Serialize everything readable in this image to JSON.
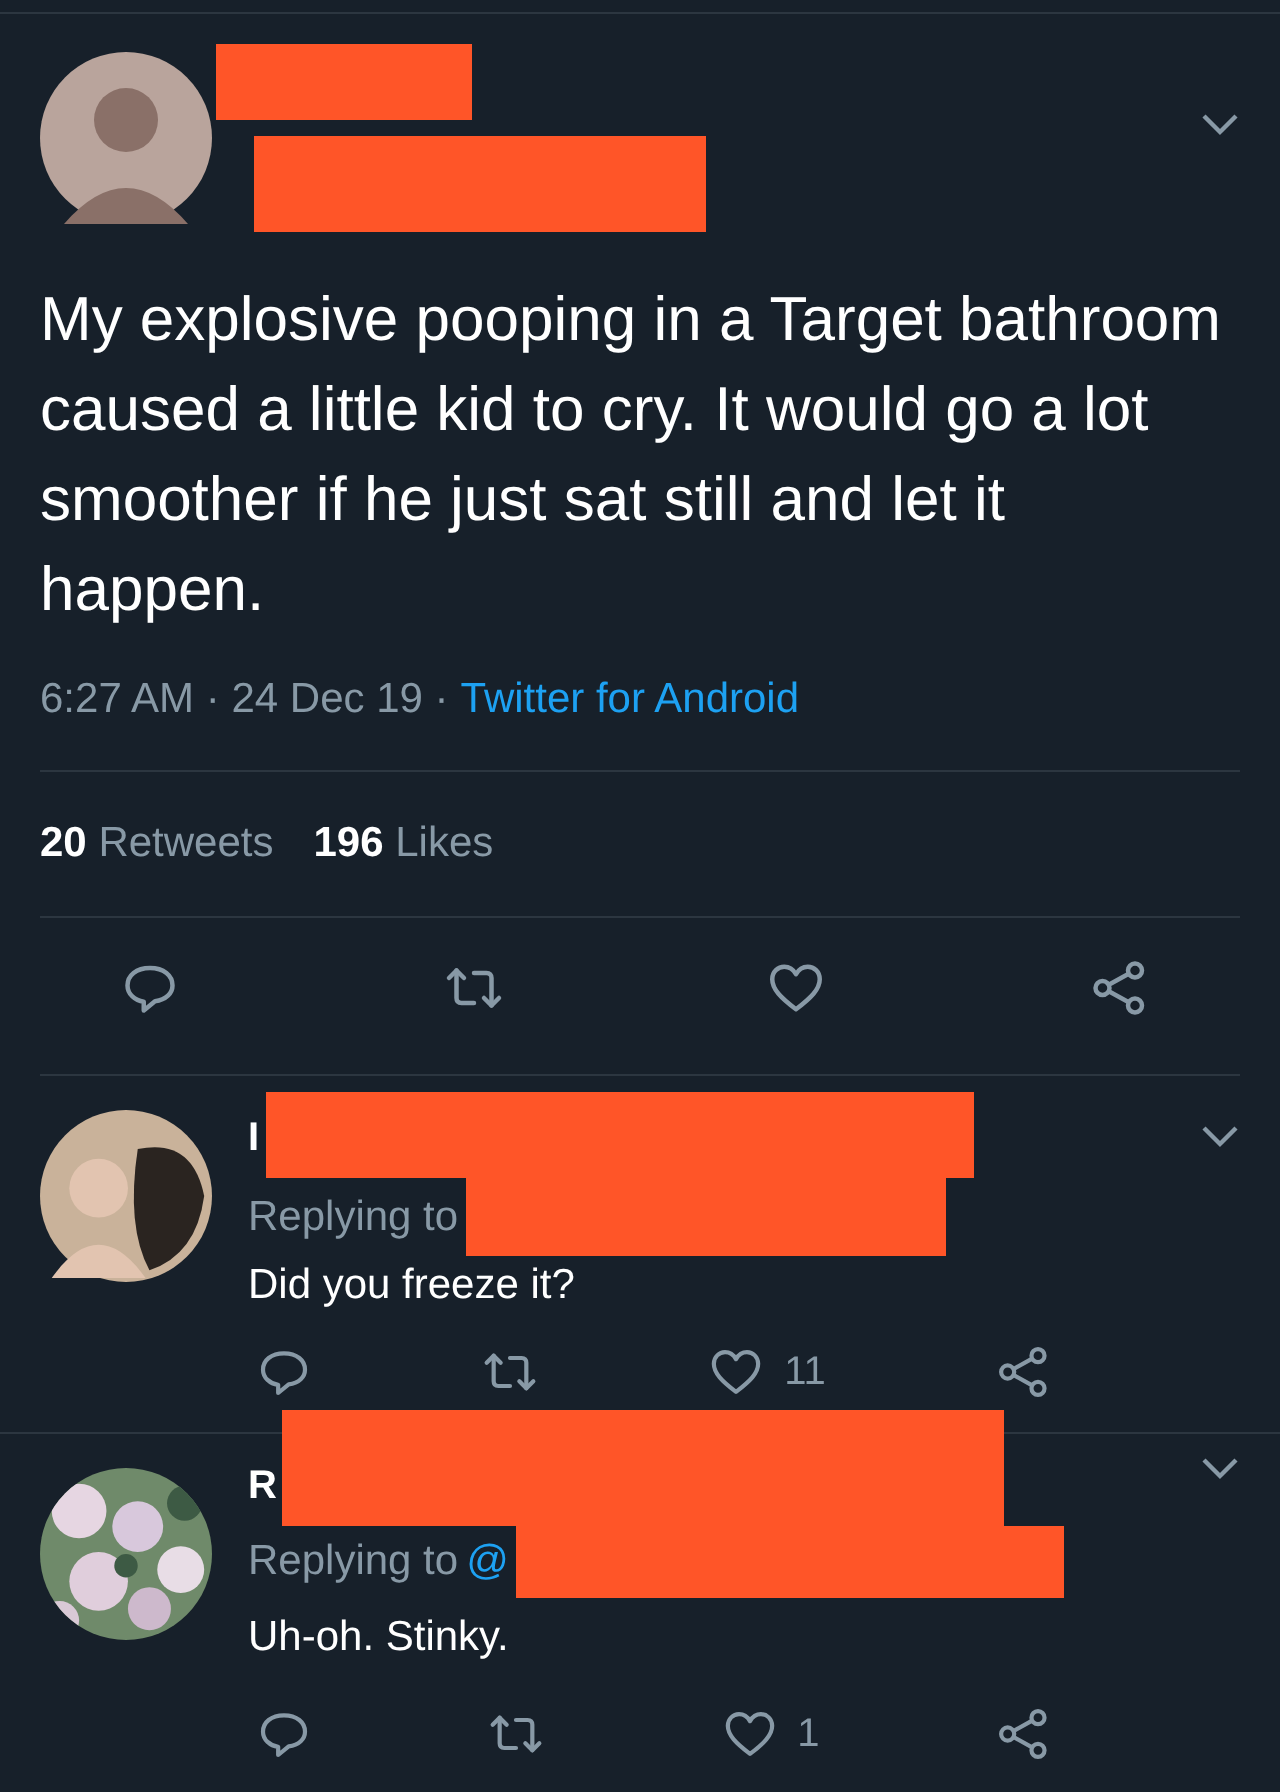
{
  "tweet": {
    "author": {
      "redacted": true
    },
    "text": "My explosive pooping in a Target bathroom caused a little kid to cry. It would go a lot smoother if he just sat still and let it happen.",
    "meta": "6:27 AM · 24 Dec 19 ·",
    "source": "Twitter for Android",
    "stats": [
      {
        "count": "20",
        "label": "Retweets"
      },
      {
        "count": "196",
        "label": "Likes"
      }
    ],
    "actions": [
      {
        "kind": "reply"
      },
      {
        "kind": "retweet"
      },
      {
        "kind": "like"
      },
      {
        "kind": "share"
      }
    ]
  },
  "replies": [
    {
      "avatar": {
        "kind": "person"
      },
      "name": "I",
      "redacted": true,
      "replying_label": "Replying to",
      "text": "Did you freeze it?",
      "actions": [
        {
          "kind": "reply"
        },
        {
          "kind": "retweet"
        },
        {
          "kind": "like",
          "count": "11"
        },
        {
          "kind": "share"
        }
      ]
    },
    {
      "name": "R",
      "redacted": true,
      "replying_label": "Replying to",
      "mention": "@",
      "text": "Uh-oh. Stinky.",
      "actions": [
        {
          "kind": "reply"
        },
        {
          "kind": "retweet"
        },
        {
          "kind": "like",
          "count": "1"
        },
        {
          "kind": "share"
        }
      ]
    }
  ]
}
